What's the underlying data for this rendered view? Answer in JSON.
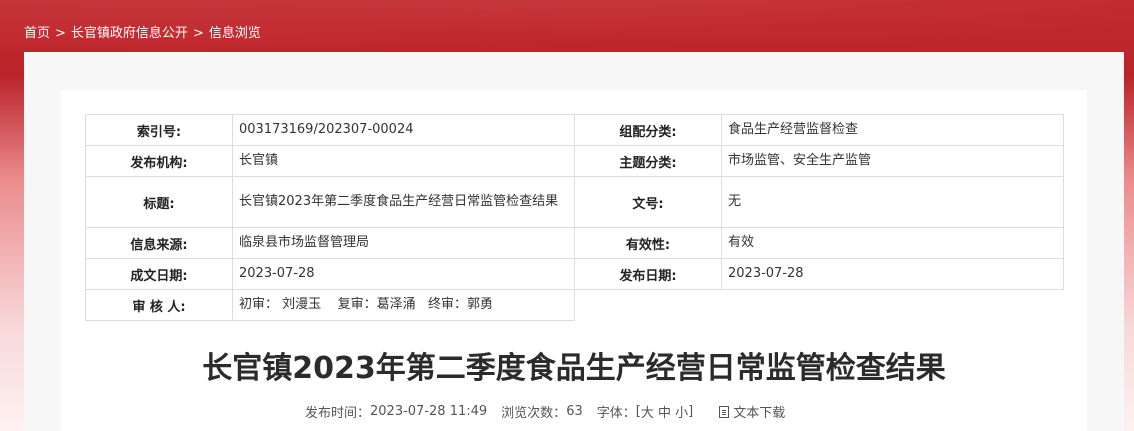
{
  "breadcrumb": [
    "首页",
    "长官镇政府信息公开",
    "信息浏览"
  ],
  "breadcrumb_sep": ">",
  "meta": {
    "index_label": "索引号:",
    "index_value": "003173169/202307-00024",
    "category_label": "组配分类:",
    "category_value": "食品生产经营监督检查",
    "publisher_label": "发布机构:",
    "publisher_value": "长官镇",
    "topic_label": "主题分类:",
    "topic_value": "市场监管、安全生产监管",
    "title_label": "标题:",
    "title_value": "长官镇2023年第二季度食品生产经营日常监管检查结果",
    "docno_label": "文号:",
    "docno_value": "无",
    "source_label": "信息来源:",
    "source_value": "临泉县市场监督管理局",
    "validity_label": "有效性:",
    "validity_value": "有效",
    "created_label": "成文日期:",
    "created_value": "2023-07-28",
    "released_label": "发布日期:",
    "released_value": "2023-07-28",
    "review_label": "审 核 人:",
    "review_value": "初审： 刘漫玉    复审：葛泽涌   终审：郭勇"
  },
  "article": {
    "title": "长官镇2023年第二季度食品生产经营日常监管检查结果",
    "publish_time_label": "发布时间：",
    "publish_time": "2023-07-28 11:49",
    "views_label": "浏览次数：",
    "views": "63",
    "font_label": "字体：",
    "font_open": "[",
    "font_large": "大",
    "font_medium": "中",
    "font_small": "小",
    "font_close": "]",
    "download_label": "文本下载"
  }
}
